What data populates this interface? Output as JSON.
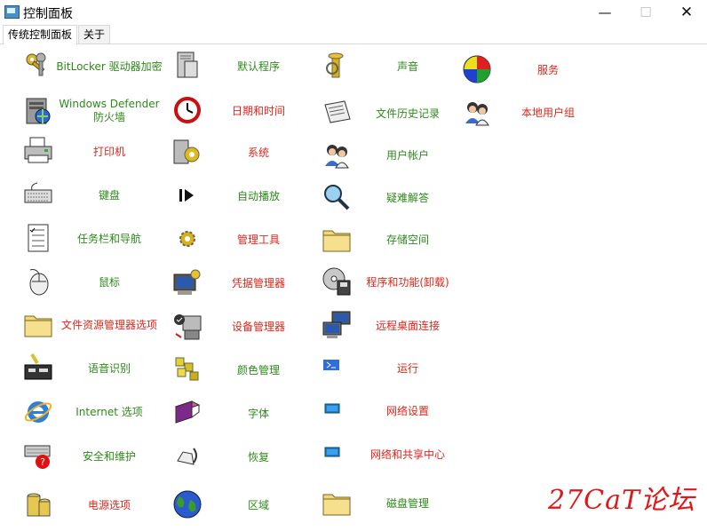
{
  "window": {
    "title": "控制面板"
  },
  "tabs": [
    "传统控制面板",
    "关于"
  ],
  "items": [
    {
      "label": "BitLocker 驱动器加密",
      "color": "green",
      "icon": "keys-icon"
    },
    {
      "label": "Windows Defender 防火墙",
      "color": "green",
      "icon": "firewall-icon"
    },
    {
      "label": "打印机",
      "color": "red",
      "icon": "printer-icon"
    },
    {
      "label": "键盘",
      "color": "green",
      "icon": "keyboard-icon"
    },
    {
      "label": "任务栏和导航",
      "color": "green",
      "icon": "checklist-icon"
    },
    {
      "label": "鼠标",
      "color": "green",
      "icon": "mouse-icon"
    },
    {
      "label": "文件资源管理器选项",
      "color": "red",
      "icon": "folder-icon"
    },
    {
      "label": "语音识别",
      "color": "green",
      "icon": "speech-icon"
    },
    {
      "label": "Internet 选项",
      "color": "green",
      "icon": "ie-icon"
    },
    {
      "label": "安全和维护",
      "color": "green",
      "icon": "security-icon"
    },
    {
      "label": "电源选项",
      "color": "red",
      "icon": "battery-icon"
    },
    {
      "label": "默认程序",
      "color": "green",
      "icon": "computer-tower-icon"
    },
    {
      "label": "日期和时间",
      "color": "red",
      "icon": "clock-icon"
    },
    {
      "label": "系统",
      "color": "red",
      "icon": "system-icon"
    },
    {
      "label": "自动播放",
      "color": "green",
      "icon": "play-icon"
    },
    {
      "label": "管理工具",
      "color": "red",
      "icon": "gear-icon"
    },
    {
      "label": "凭据管理器",
      "color": "red",
      "icon": "credential-icon"
    },
    {
      "label": "设备管理器",
      "color": "red",
      "icon": "device-icon"
    },
    {
      "label": "颜色管理",
      "color": "green",
      "icon": "cubes-icon"
    },
    {
      "label": "字体",
      "color": "green",
      "icon": "book-icon"
    },
    {
      "label": "恢复",
      "color": "green",
      "icon": "restore-icon"
    },
    {
      "label": "区域",
      "color": "green",
      "icon": "globe-icon"
    },
    {
      "label": "声音",
      "color": "green",
      "icon": "tuba-icon"
    },
    {
      "label": "文件历史记录",
      "color": "green",
      "icon": "newspaper-icon"
    },
    {
      "label": "用户帐户",
      "color": "green",
      "icon": "users-icon"
    },
    {
      "label": "疑难解答",
      "color": "green",
      "icon": "magnifier-icon"
    },
    {
      "label": "存储空间",
      "color": "green",
      "icon": "folder-icon"
    },
    {
      "label": "程序和功能(卸载)",
      "color": "red",
      "icon": "cd-drive-icon"
    },
    {
      "label": "远程桌面连接",
      "color": "red",
      "icon": "remote-desktop-icon"
    },
    {
      "label": "运行",
      "color": "red",
      "icon": "run-icon"
    },
    {
      "label": "网络设置",
      "color": "red",
      "icon": "network-icon"
    },
    {
      "label": "网络和共享中心",
      "color": "red",
      "icon": "network-icon"
    },
    {
      "label": "磁盘管理",
      "color": "green",
      "icon": "folder-icon"
    },
    {
      "label": "服务",
      "color": "red",
      "icon": "ball-icon"
    },
    {
      "label": "本地用户组",
      "color": "red",
      "icon": "users-icon"
    }
  ],
  "watermark": "27CaT论坛"
}
